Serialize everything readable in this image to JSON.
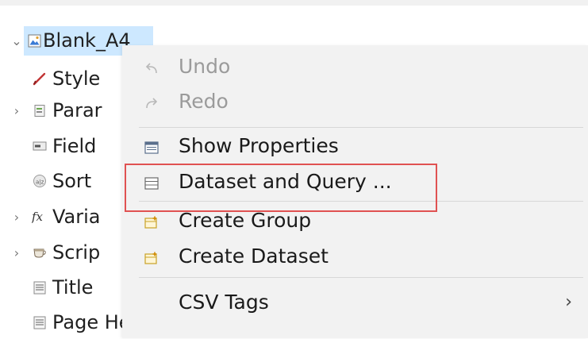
{
  "tree": {
    "root": {
      "label": "Blank_A4",
      "expanded": true
    },
    "children": [
      {
        "label": "Style",
        "icon": "style-icon",
        "has_toggle": false
      },
      {
        "label": "Parar",
        "icon": "parameters-icon",
        "has_toggle": true
      },
      {
        "label": "Field",
        "icon": "fields-icon",
        "has_toggle": false
      },
      {
        "label": "Sort",
        "icon": "sort-icon",
        "has_toggle": false
      },
      {
        "label": "Varia",
        "icon": "variables-icon",
        "has_toggle": true
      },
      {
        "label": "Scrip",
        "icon": "scriptlets-icon",
        "has_toggle": true
      },
      {
        "label": "Title",
        "icon": "band-icon",
        "has_toggle": false
      },
      {
        "label": "Page Header",
        "icon": "band-icon",
        "has_toggle": false
      }
    ]
  },
  "context_menu": {
    "items": [
      {
        "label": "Undo",
        "icon": "undo-icon",
        "enabled": false
      },
      {
        "label": "Redo",
        "icon": "redo-icon",
        "enabled": false
      },
      {
        "label": "Show Properties",
        "icon": "properties-icon",
        "enabled": true
      },
      {
        "label": "Dataset and Query ...",
        "icon": "dataset-query-icon",
        "enabled": true,
        "highlighted": true
      },
      {
        "label": "Create Group",
        "icon": "create-group-icon",
        "enabled": true
      },
      {
        "label": "Create Dataset",
        "icon": "create-dataset-icon",
        "enabled": true
      },
      {
        "label": "CSV Tags",
        "icon": "",
        "enabled": true,
        "submenu": true
      }
    ]
  },
  "colors": {
    "selection": "#cde8ff",
    "menu_background": "#f2f2f2",
    "highlight_border": "#e05252",
    "disabled_text": "#9b9b9b"
  }
}
